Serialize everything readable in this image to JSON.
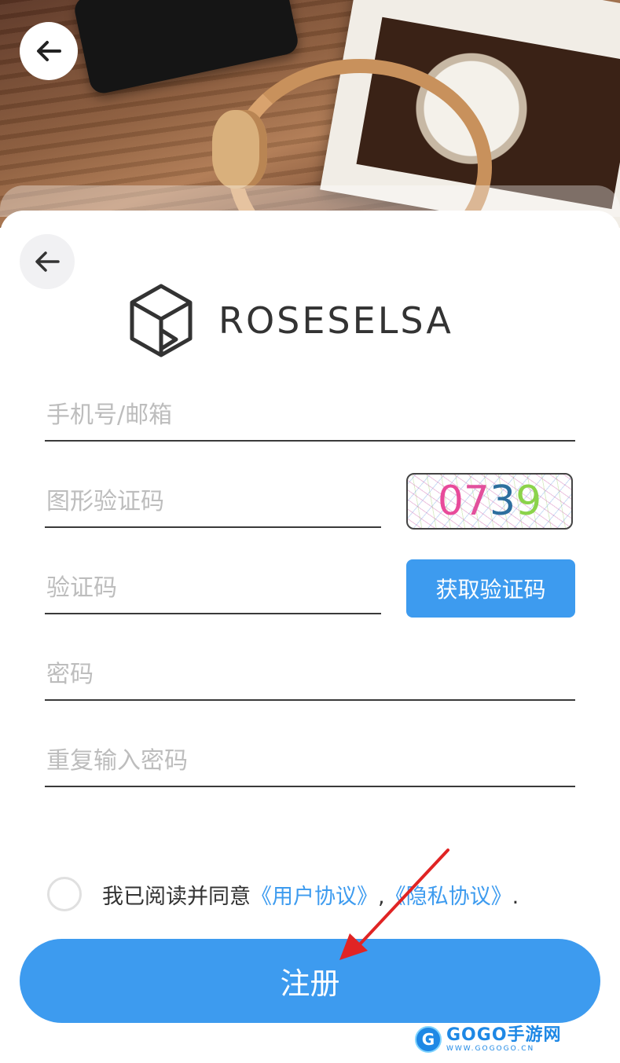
{
  "hero": {
    "back_icon": "arrow-left-icon"
  },
  "card": {
    "back_icon": "arrow-left-icon"
  },
  "logo": {
    "icon": "hexagon-logo-icon",
    "text": "ROSESELSA"
  },
  "form": {
    "phone_email_placeholder": "手机号/邮箱",
    "captcha_placeholder": "图形验证码",
    "captcha_image_digits": [
      "0",
      "7",
      "3",
      "9"
    ],
    "captcha_digit_colors": [
      "#e84a9a",
      "#e2509c",
      "#2c6f9e",
      "#8bd34a"
    ],
    "code_placeholder": "验证码",
    "get_code_label": "获取验证码",
    "password_placeholder": "密码",
    "confirm_password_placeholder": "重复输入密码"
  },
  "agreement": {
    "prefix": "我已阅读并同意",
    "user_agreement": "《用户协议》",
    "separator": ",",
    "privacy_agreement": "《隐私协议》",
    "suffix": "."
  },
  "register_label": "注册",
  "watermark": {
    "main": "GOGO手游网",
    "sub": "WWW.GOGOGO.CN"
  },
  "colors": {
    "accent": "#3d9bef",
    "annotation_arrow": "#e02424"
  }
}
